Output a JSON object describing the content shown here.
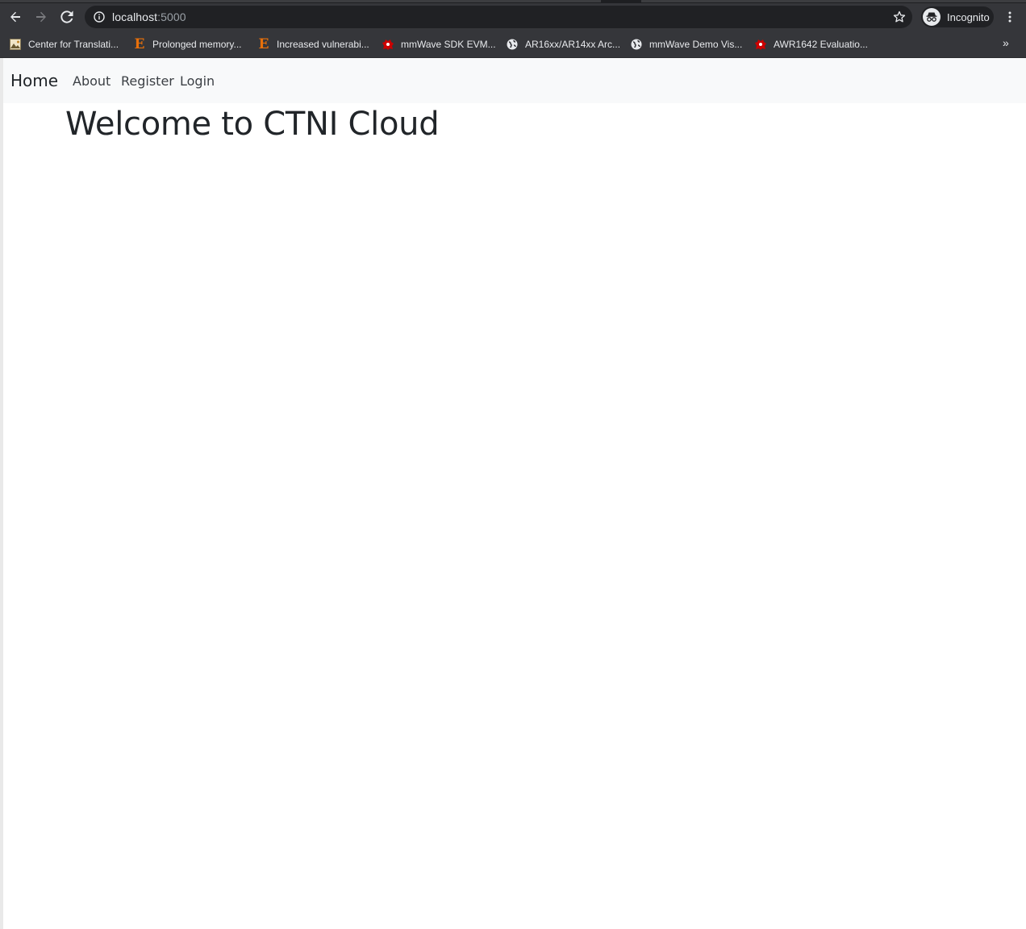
{
  "browser": {
    "address": {
      "host": "localhost",
      "port": ":5000"
    },
    "incognito_label": "Incognito",
    "bookmarks": [
      {
        "label": "Center for Translati...",
        "icon": "landscape-favicon"
      },
      {
        "label": "Prolonged memory...",
        "icon": "e-letter-favicon"
      },
      {
        "label": "Increased vulnerabi...",
        "icon": "e-letter-favicon"
      },
      {
        "label": "mmWave SDK EVM...",
        "icon": "ti-logo-favicon"
      },
      {
        "label": "AR16xx/AR14xx Arc...",
        "icon": "globe-icon"
      },
      {
        "label": "mmWave Demo Vis...",
        "icon": "globe-icon"
      },
      {
        "label": "AWR1642 Evaluatio...",
        "icon": "ti-logo-favicon"
      }
    ],
    "overflow_label": "»"
  },
  "page": {
    "navbar": {
      "brand": "Home",
      "links": [
        "About",
        "Register",
        "Login"
      ]
    },
    "heading": "Welcome to CTNI Cloud"
  },
  "colors": {
    "chrome_toolbar": "#35363a",
    "omnibox": "#202124",
    "navbar_bg": "#f8f9fa",
    "text_dark": "#212529",
    "favicon_orange": "#e8700a",
    "ti_red": "#cc0000"
  }
}
